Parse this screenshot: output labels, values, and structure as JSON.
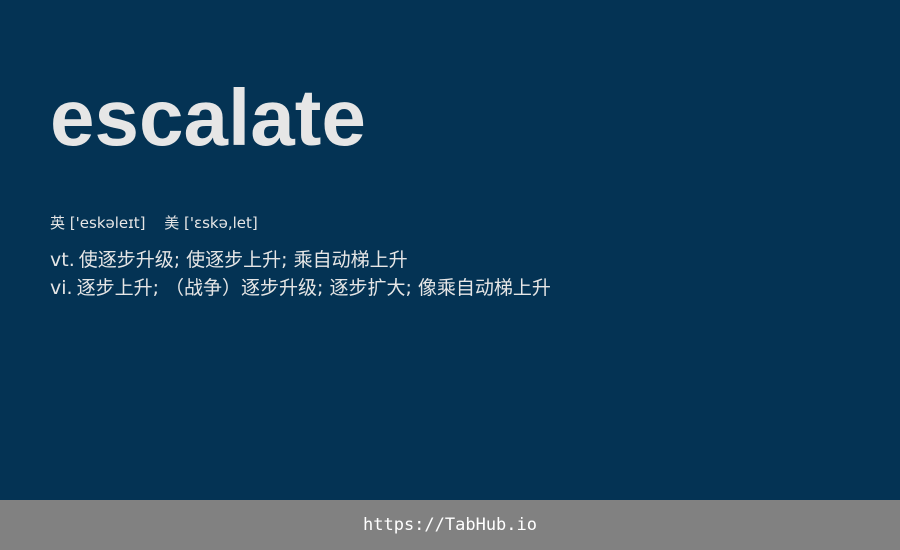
{
  "entry": {
    "word": "escalate",
    "phonetics": {
      "uk_label": "英",
      "uk_ipa": "['eskəleɪt]",
      "us_label": "美",
      "us_ipa": "['ɛskə,let]"
    },
    "definitions": [
      {
        "pos": "vt.",
        "meaning": "使逐步升级; 使逐步上升; 乘自动梯上升"
      },
      {
        "pos": "vi.",
        "meaning": "逐步上升; （战争）逐步升级; 逐步扩大; 像乘自动梯上升"
      }
    ]
  },
  "footer": {
    "link_text": "https://TabHub.io"
  },
  "colors": {
    "background": "#043354",
    "text": "#e6e6e6",
    "footer_bg": "#818181",
    "footer_text": "#ffffff"
  }
}
